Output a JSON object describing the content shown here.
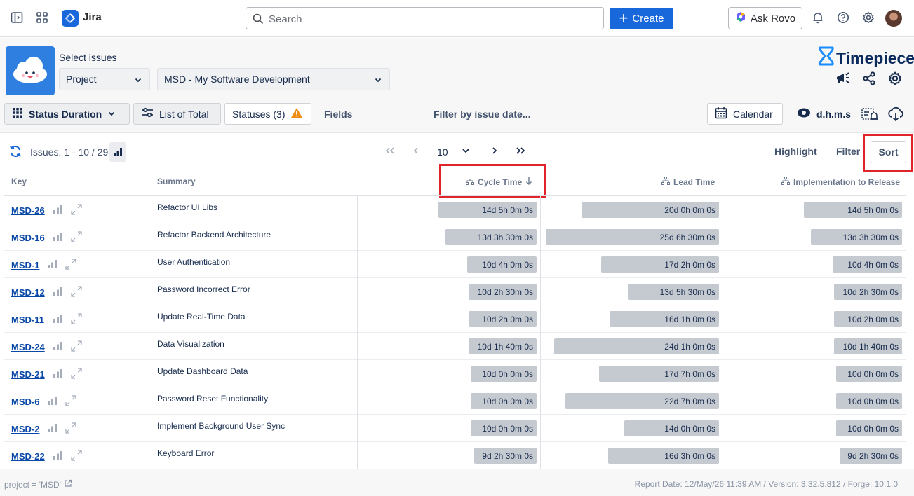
{
  "topbar": {
    "app_name": "Jira",
    "search_placeholder": "Search",
    "create_label": "Create",
    "ask_rovo_label": "Ask Rovo"
  },
  "app": {
    "select_issues_label": "Select issues",
    "project_dropdown": "Project",
    "project_value": "MSD - My Software Development",
    "brand": "Timepiece"
  },
  "toolbar": {
    "status_duration": "Status Duration",
    "list_of_total": "List of Total",
    "statuses": "Statuses (3)",
    "fields": "Fields",
    "filter_by_date": "Filter by issue date...",
    "calendar": "Calendar",
    "time_format": "d.h.m.s"
  },
  "pager": {
    "issues_count": "Issues: 1 - 10 / 29",
    "page_size": "10",
    "highlight": "Highlight",
    "filter": "Filter",
    "sort": "Sort"
  },
  "table": {
    "headers": {
      "key": "Key",
      "summary": "Summary",
      "cycle_time": "Cycle Time",
      "lead_time": "Lead Time",
      "impl_to_release": "Implementation to Release"
    },
    "rows": [
      {
        "key": "MSD-26",
        "summary": "Refactor UI Libs",
        "cycle": "14d 5h 0m 0s",
        "cycle_f": 0.55,
        "lead": "20d 0h 0m 0s",
        "lead_f": 0.77,
        "impl": "14d 5h 0m 0s",
        "impl_f": 0.55
      },
      {
        "key": "MSD-16",
        "summary": "Refactor Backend Architecture",
        "cycle": "13d 3h 30m 0s",
        "cycle_f": 0.51,
        "lead": "25d 6h 30m 0s",
        "lead_f": 0.97,
        "impl": "13d 3h 30m 0s",
        "impl_f": 0.51
      },
      {
        "key": "MSD-1",
        "summary": "User Authentication",
        "cycle": "10d 4h 0m 0s",
        "cycle_f": 0.39,
        "lead": "17d 2h 0m 0s",
        "lead_f": 0.66,
        "impl": "10d 4h 0m 0s",
        "impl_f": 0.39
      },
      {
        "key": "MSD-12",
        "summary": "Password Incorrect Error",
        "cycle": "10d 2h 30m 0s",
        "cycle_f": 0.38,
        "lead": "13d 5h 30m 0s",
        "lead_f": 0.51,
        "impl": "10d 2h 30m 0s",
        "impl_f": 0.38
      },
      {
        "key": "MSD-11",
        "summary": "Update Real-Time Data",
        "cycle": "10d 2h 0m 0s",
        "cycle_f": 0.38,
        "lead": "16d 1h 0m 0s",
        "lead_f": 0.61,
        "impl": "10d 2h 0m 0s",
        "impl_f": 0.38
      },
      {
        "key": "MSD-24",
        "summary": "Data Visualization",
        "cycle": "10d 1h 40m 0s",
        "cycle_f": 0.38,
        "lead": "24d 1h 0m 0s",
        "lead_f": 0.92,
        "impl": "10d 1h 40m 0s",
        "impl_f": 0.38
      },
      {
        "key": "MSD-21",
        "summary": "Update Dashboard Data",
        "cycle": "10d 0h 0m 0s",
        "cycle_f": 0.37,
        "lead": "17d 7h 0m 0s",
        "lead_f": 0.67,
        "impl": "10d 0h 0m 0s",
        "impl_f": 0.37
      },
      {
        "key": "MSD-6",
        "summary": "Password Reset Functionality",
        "cycle": "10d 0h 0m 0s",
        "cycle_f": 0.37,
        "lead": "22d 7h 0m 0s",
        "lead_f": 0.86,
        "impl": "10d 0h 0m 0s",
        "impl_f": 0.37
      },
      {
        "key": "MSD-2",
        "summary": "Implement Background User Sync",
        "cycle": "10d 0h 0m 0s",
        "cycle_f": 0.37,
        "lead": "14d 0h 0m 0s",
        "lead_f": 0.53,
        "impl": "10d 0h 0m 0s",
        "impl_f": 0.37
      },
      {
        "key": "MSD-22",
        "summary": "Keyboard Error",
        "cycle": "9d 2h 30m 0s",
        "cycle_f": 0.35,
        "lead": "16d 3h 0m 0s",
        "lead_f": 0.62,
        "impl": "9d 2h 30m 0s",
        "impl_f": 0.35
      }
    ]
  },
  "footer": {
    "jql": "project = 'MSD'",
    "report_info": "Report Date: 12/May/26 11:39 AM / Version: 3.32.5.812 / Forge: 10.1.0"
  },
  "colors": {
    "primary": "#1868db",
    "bar": "#c5c9d0",
    "highlight_box": "#e0242b",
    "warning": "#f18d13"
  }
}
